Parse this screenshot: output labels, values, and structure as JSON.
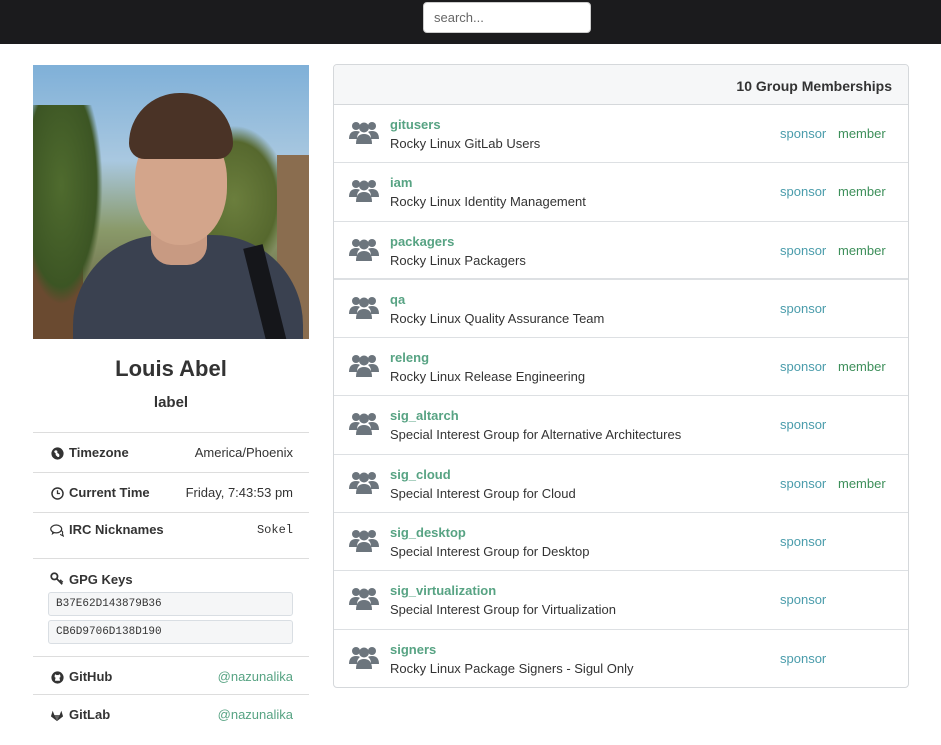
{
  "search": {
    "placeholder": "search..."
  },
  "profile": {
    "name": "Louis Abel",
    "label": "label",
    "photo_alt": "profile-photo",
    "timezone": {
      "key": "Timezone",
      "value": "America/Phoenix",
      "icon": "globe-icon"
    },
    "current_time": {
      "key": "Current Time",
      "value": "Friday, 7:43:53 pm",
      "icon": "clock-icon"
    },
    "irc": {
      "key": "IRC Nicknames",
      "value": "Sokel",
      "icon": "chat-icon"
    },
    "gpg": {
      "key": "GPG Keys",
      "icon": "key-icon",
      "keys": [
        "B37E62D143879B36",
        "CB6D9706D138D190"
      ]
    },
    "github": {
      "key": "GitHub",
      "value": "@nazunalika",
      "icon": "github-icon"
    },
    "gitlab": {
      "key": "GitLab",
      "value": "@nazunalika",
      "icon": "gitlab-icon"
    }
  },
  "groups": {
    "header": "10 Group Memberships",
    "items": [
      {
        "name": "gitusers",
        "description": "Rocky Linux GitLab Users",
        "sponsor": "sponsor",
        "member": "member"
      },
      {
        "name": "iam",
        "description": "Rocky Linux Identity Management",
        "sponsor": "sponsor",
        "member": "member"
      },
      {
        "name": "packagers",
        "description": "Rocky Linux Packagers",
        "sponsor": "sponsor",
        "member": "member"
      },
      {
        "name": "qa",
        "description": "Rocky Linux Quality Assurance Team",
        "sponsor": "sponsor",
        "member": ""
      },
      {
        "name": "releng",
        "description": "Rocky Linux Release Engineering",
        "sponsor": "sponsor",
        "member": "member"
      },
      {
        "name": "sig_altarch",
        "description": "Special Interest Group for Alternative Architectures",
        "sponsor": "sponsor",
        "member": ""
      },
      {
        "name": "sig_cloud",
        "description": "Special Interest Group for Cloud",
        "sponsor": "sponsor",
        "member": "member"
      },
      {
        "name": "sig_desktop",
        "description": "Special Interest Group for Desktop",
        "sponsor": "sponsor",
        "member": ""
      },
      {
        "name": "sig_virtualization",
        "description": "Special Interest Group for Virtualization",
        "sponsor": "sponsor",
        "member": ""
      },
      {
        "name": "signers",
        "description": "Rocky Linux Package Signers - Sigul Only",
        "sponsor": "sponsor",
        "member": ""
      }
    ]
  },
  "colors": {
    "topbar": "#1b1b1d",
    "link_green": "#57a383",
    "sponsor_teal": "#4a9cab",
    "member_green": "#3d8f5a",
    "group_icon": "#6c757d"
  }
}
